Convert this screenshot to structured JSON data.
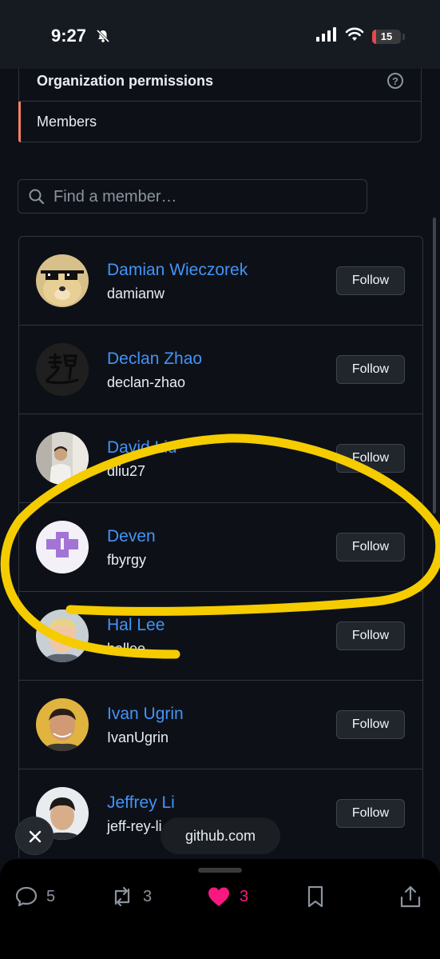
{
  "status_bar": {
    "time": "9:27",
    "battery": "15",
    "battery_level": 0.15
  },
  "permissions": {
    "title": "Organization permissions",
    "help_icon": "question-circle-icon",
    "active_item": "Members"
  },
  "search": {
    "placeholder": "Find a member…"
  },
  "members": [
    {
      "name": "Damian Wieczorek",
      "login": "damianw",
      "follow": "Follow"
    },
    {
      "name": "Declan Zhao",
      "login": "declan-zhao",
      "follow": "Follow"
    },
    {
      "name": "David Liu",
      "login": "dliu27",
      "follow": "Follow"
    },
    {
      "name": "Deven",
      "login": "fbyrgy",
      "follow": "Follow"
    },
    {
      "name": "Hal Lee",
      "login": "hallee",
      "follow": "Follow"
    },
    {
      "name": "Ivan Ugrin",
      "login": "IvanUgrin",
      "follow": "Follow"
    },
    {
      "name": "Jeffrey Li",
      "login": "jeff-rey-li",
      "follow": "Follow"
    }
  ],
  "overlay": {
    "domain": "github.com",
    "close_icon": "close-icon",
    "highlight_color": "#f5cc00"
  },
  "post_actions": {
    "replies": "5",
    "reposts": "3",
    "likes": "3",
    "like_color": "#f91880"
  }
}
